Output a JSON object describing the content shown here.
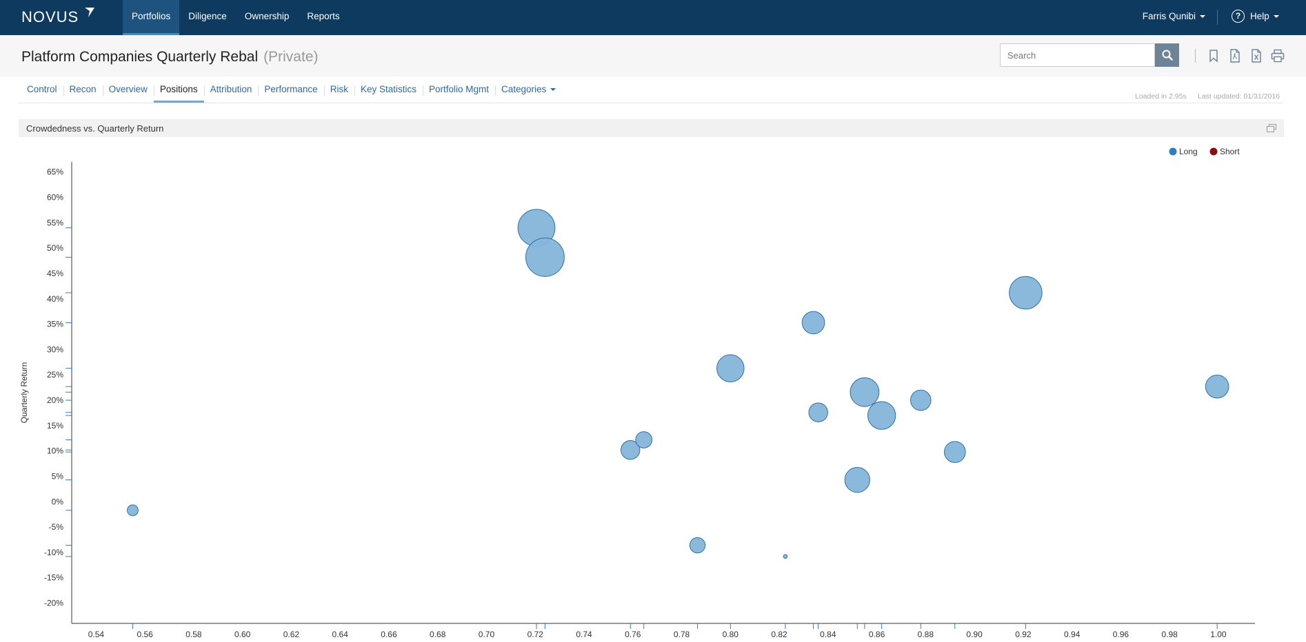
{
  "app": {
    "logo": "NOVUS"
  },
  "nav": {
    "items": [
      {
        "label": "Portfolios",
        "active": true
      },
      {
        "label": "Diligence",
        "active": false
      },
      {
        "label": "Ownership",
        "active": false
      },
      {
        "label": "Reports",
        "active": false
      }
    ]
  },
  "user": {
    "name": "Farris Qunibi",
    "help_label": "Help"
  },
  "page": {
    "title": "Platform Companies Quarterly Rebal",
    "subtitle": "(Private)"
  },
  "search": {
    "placeholder": "Search"
  },
  "toolbar": {
    "icons": [
      "bookmark-icon",
      "pdf-icon",
      "excel-icon",
      "print-icon"
    ]
  },
  "tabs": [
    {
      "label": "Control",
      "active": false
    },
    {
      "label": "Recon",
      "active": false
    },
    {
      "label": "Overview",
      "active": false
    },
    {
      "label": "Positions",
      "active": true
    },
    {
      "label": "Attribution",
      "active": false
    },
    {
      "label": "Performance",
      "active": false
    },
    {
      "label": "Risk",
      "active": false
    },
    {
      "label": "Key Statistics",
      "active": false
    },
    {
      "label": "Portfolio Mgmt",
      "active": false
    },
    {
      "label": "Categories",
      "active": false,
      "dropdown": true
    }
  ],
  "meta": {
    "loaded": "Loaded in 2.95s",
    "updated": "Last updated: 01/31/2016"
  },
  "panel": {
    "title": "Crowdedness vs. Quarterly Return"
  },
  "colors": {
    "long": "#2e7cc1",
    "short": "#8b0d0d",
    "bubble_fill": "#85b5da",
    "bubble_stroke": "#2e6ea6",
    "nav_bg": "#0d3a5e"
  },
  "chart_data": {
    "type": "scatter",
    "title": "Crowdedness vs. Quarterly Return",
    "xlabel": "",
    "ylabel": "Quarterly Return",
    "xlim": [
      0.53,
      1.015
    ],
    "ylim": [
      -24,
      67
    ],
    "x_ticks": [
      0.54,
      0.56,
      0.58,
      0.6,
      0.62,
      0.64,
      0.66,
      0.68,
      0.7,
      0.72,
      0.74,
      0.76,
      0.78,
      0.8,
      0.82,
      0.84,
      0.86,
      0.88,
      0.9,
      0.92,
      0.94,
      0.96,
      0.98,
      1.0
    ],
    "x_tick_labels": [
      "0.54",
      "0.56",
      "0.58",
      "0.60",
      "0.62",
      "0.64",
      "0.66",
      "0.68",
      "0.70",
      "0.72",
      "0.74",
      "0.76",
      "0.78",
      "0.80",
      "0.82",
      "0.84",
      "0.86",
      "0.88",
      "0.90",
      "0.92",
      "0.94",
      "0.96",
      "0.98",
      "1.00"
    ],
    "y_ticks": [
      65,
      60,
      55,
      50,
      45,
      40,
      35,
      30,
      25,
      20,
      15,
      10,
      5,
      0,
      -5,
      -10,
      -15,
      -20
    ],
    "y_tick_labels": [
      "65%",
      "60%",
      "55%",
      "50%",
      "45%",
      "40%",
      "35%",
      "30%",
      "25%",
      "20%",
      "15%",
      "10%",
      "5%",
      "0%",
      "-5%",
      "-10%",
      "-15%",
      "-20%"
    ],
    "legend": {
      "position": "top-right",
      "entries": [
        "Long",
        "Short"
      ]
    },
    "grid": false,
    "series": [
      {
        "name": "Long",
        "points": [
          {
            "x": 0.555,
            "y": -1.7,
            "size": 0.4
          },
          {
            "x": 0.7205,
            "y": 54,
            "size": 4.6
          },
          {
            "x": 0.724,
            "y": 48.2,
            "size": 5.0
          },
          {
            "x": 0.759,
            "y": 10.2,
            "size": 1.2
          },
          {
            "x": 0.7645,
            "y": 12.2,
            "size": 0.9
          },
          {
            "x": 0.7865,
            "y": -8.6,
            "size": 0.8
          },
          {
            "x": 0.8,
            "y": 26.3,
            "size": 2.5
          },
          {
            "x": 0.8225,
            "y": -10.8,
            "size": 0.05
          },
          {
            "x": 0.834,
            "y": 35.3,
            "size": 1.7
          },
          {
            "x": 0.836,
            "y": 17.6,
            "size": 1.2
          },
          {
            "x": 0.852,
            "y": 4.3,
            "size": 2.1
          },
          {
            "x": 0.855,
            "y": 21.6,
            "size": 2.8
          },
          {
            "x": 0.862,
            "y": 17.0,
            "size": 2.6
          },
          {
            "x": 0.878,
            "y": 20.0,
            "size": 1.4
          },
          {
            "x": 0.892,
            "y": 9.8,
            "size": 1.5
          },
          {
            "x": 0.921,
            "y": 41.2,
            "size": 3.6
          },
          {
            "x": 0.9995,
            "y": 22.7,
            "size": 1.8
          }
        ]
      },
      {
        "name": "Short",
        "points": []
      }
    ]
  }
}
